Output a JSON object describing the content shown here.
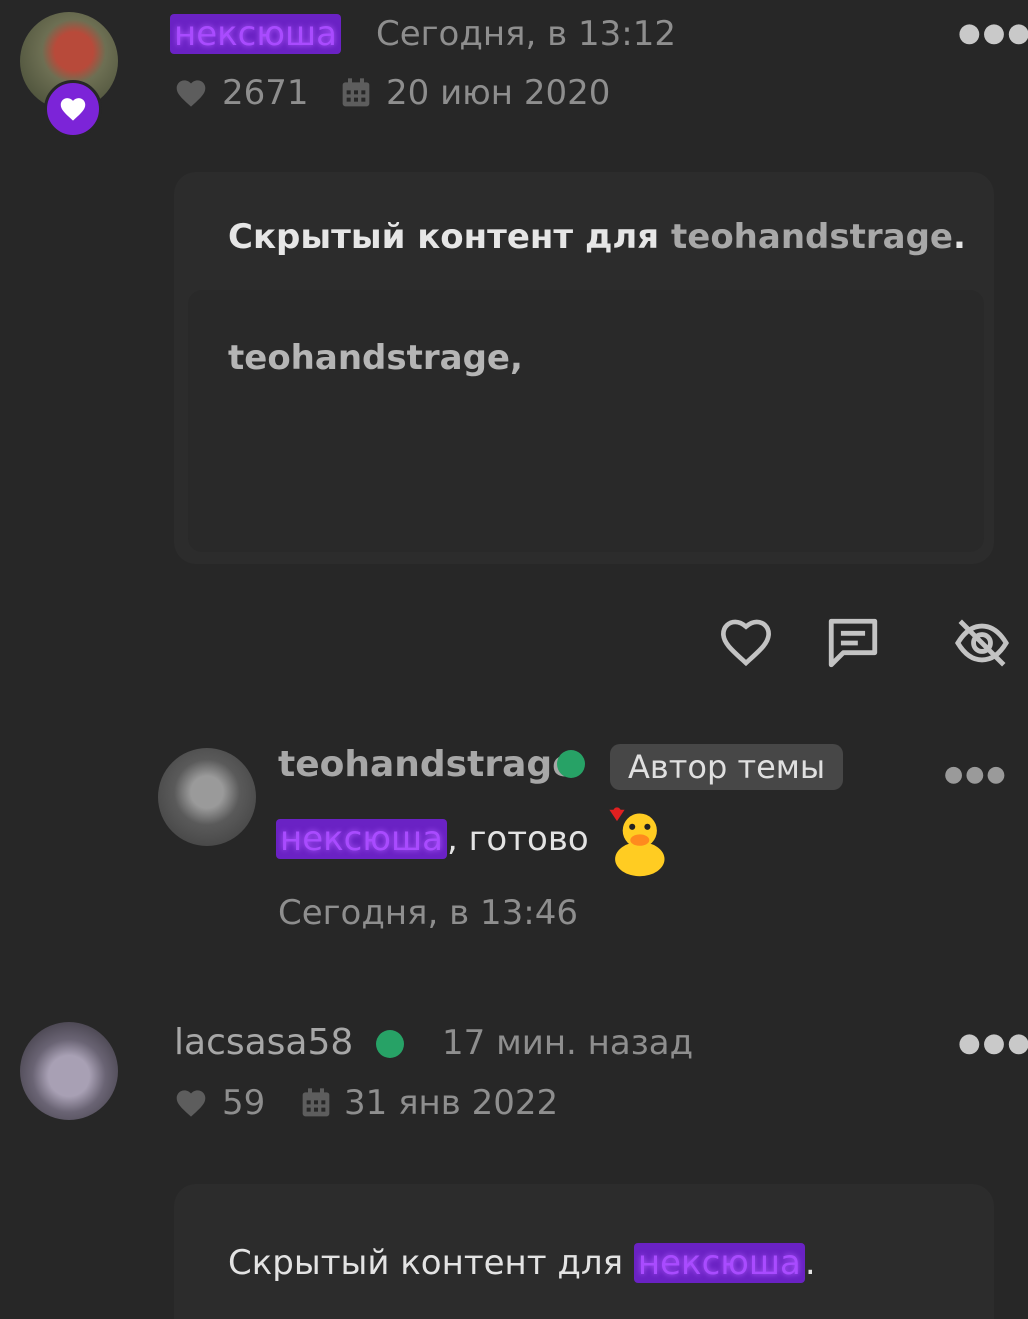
{
  "post1": {
    "author": "нексюша",
    "time": "Сегодня, в 13:12",
    "likes": "2671",
    "joined": "20 июн 2020",
    "hidden_prefix": "Скрытый контент для",
    "hidden_user": "teohandstrage",
    "hidden_suffix": ".",
    "quote_text": "teohandstrage,"
  },
  "reply": {
    "author": "teohandstrage",
    "badge": "Автор темы",
    "mention": "нексюша",
    "text": ", готово",
    "time": "Сегодня, в 13:46"
  },
  "post2": {
    "author": "lacsasa58",
    "time": "17 мин. назад",
    "likes": "59",
    "joined": "31 янв 2022",
    "hidden_prefix": "Скрытый контент для",
    "hidden_user": "нексюша",
    "hidden_suffix": "."
  },
  "colors": {
    "background": "#272727",
    "nickname_highlight": "#6a22c4",
    "online": "#27a266",
    "badge_bg": "#474747"
  },
  "icons": [
    "heart-icon",
    "calendar-icon",
    "more-icon",
    "comment-icon",
    "hide-eye-icon"
  ]
}
